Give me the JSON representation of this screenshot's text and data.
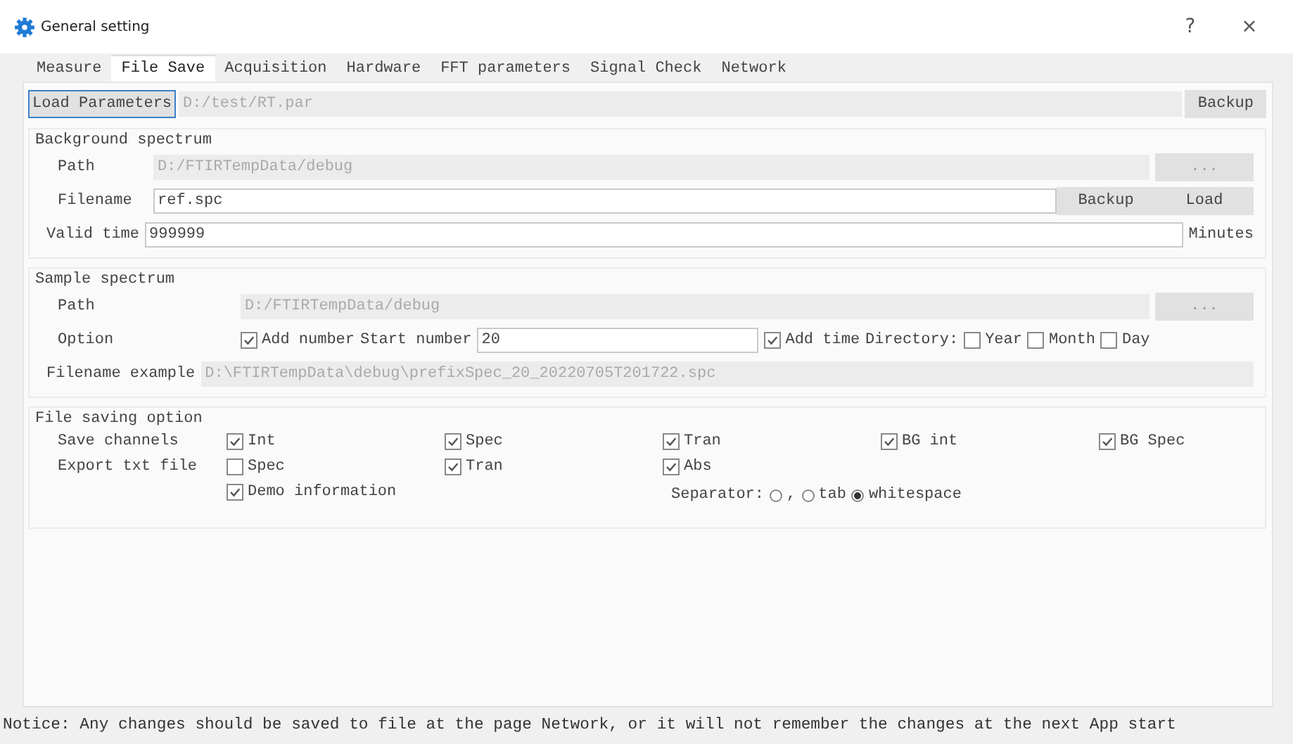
{
  "window": {
    "title": "General setting",
    "help": "?",
    "close": "×"
  },
  "tabs": [
    {
      "label": "Measure",
      "selected": false
    },
    {
      "label": "File Save",
      "selected": true
    },
    {
      "label": "Acquisition",
      "selected": false
    },
    {
      "label": "Hardware",
      "selected": false
    },
    {
      "label": "FFT parameters",
      "selected": false
    },
    {
      "label": "Signal Check",
      "selected": false
    },
    {
      "label": "Network",
      "selected": false
    }
  ],
  "load_parameters": {
    "button": "Load Parameters",
    "path": "D:/test/RT.par",
    "backup": "Backup"
  },
  "background": {
    "title": "Background spectrum",
    "path_label": "Path",
    "path": "D:/FTIRTempData/debug",
    "browse": "...",
    "filename_label": "Filename",
    "filename": "ref.spc",
    "backup": "Backup",
    "load": "Load",
    "valid_label": "Valid time",
    "valid_value": "999999",
    "unit": "Minutes"
  },
  "sample": {
    "title": "Sample spectrum",
    "path_label": "Path",
    "path": "D:/FTIRTempData/debug",
    "browse": "...",
    "option_label": "Option",
    "add_number": {
      "label": "Add number",
      "checked": true
    },
    "start_label": "Start number",
    "start_value": "20",
    "add_time": {
      "label": "Add time",
      "checked": true
    },
    "directory_label": "Directory:",
    "directory_options": [
      {
        "label": "Year",
        "checked": false
      },
      {
        "label": "Month",
        "checked": false
      },
      {
        "label": "Day",
        "checked": false
      }
    ],
    "example_label": "Filename example",
    "example": "D:\\FTIRTempData\\debug\\prefixSpec_20_20220705T201722.spc"
  },
  "file_saving": {
    "title": "File saving option",
    "save_label": "Save channels",
    "save_channels": [
      {
        "label": "Int",
        "checked": true
      },
      {
        "label": "Spec",
        "checked": true
      },
      {
        "label": "Tran",
        "checked": true
      },
      {
        "label": "BG int",
        "checked": true
      },
      {
        "label": "BG Spec",
        "checked": true
      }
    ],
    "export_label": "Export txt file",
    "export": [
      {
        "label": "Spec",
        "checked": false
      },
      {
        "label": "Tran",
        "checked": true
      },
      {
        "label": "Abs",
        "checked": true
      }
    ],
    "demo": {
      "label": "Demo information",
      "checked": true
    },
    "separator_label": "Separator:",
    "separators": [
      {
        "label": ",",
        "selected": false
      },
      {
        "label": "tab",
        "selected": false
      },
      {
        "label": "whitespace",
        "selected": true
      }
    ]
  },
  "notice": "Notice: Any changes should be saved to file at the page Network, or it will not remember the changes at the next App start"
}
